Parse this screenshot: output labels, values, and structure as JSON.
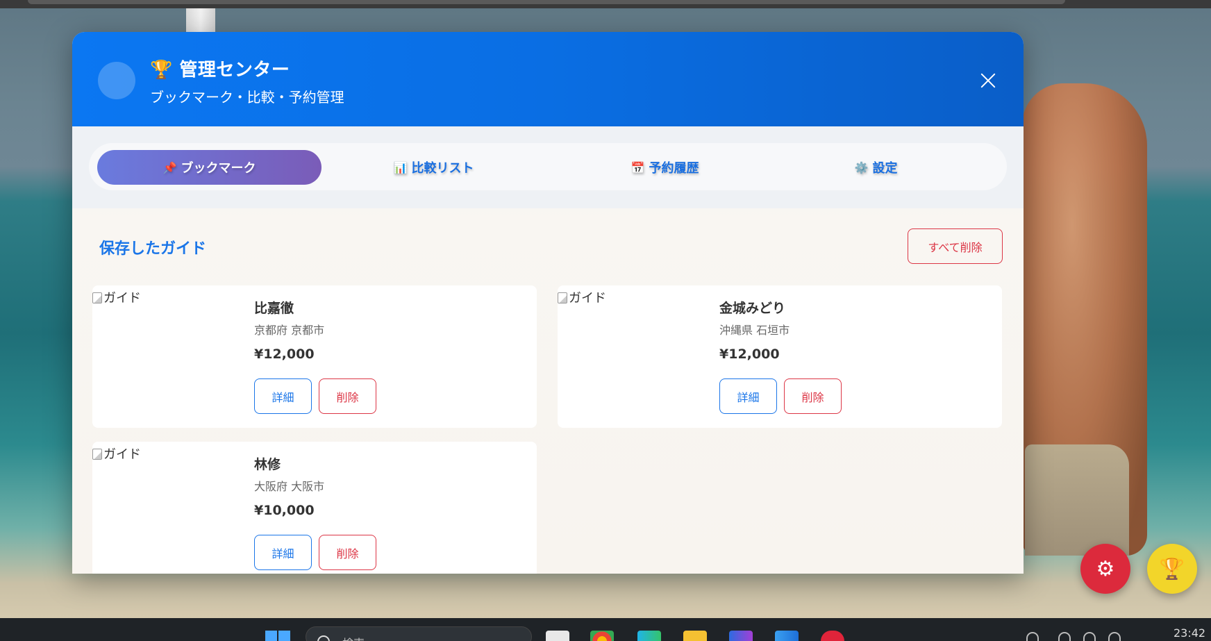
{
  "modal": {
    "title": "🏆 管理センター",
    "subtitle": "ブックマーク・比較・予約管理"
  },
  "tabs": [
    {
      "icon": "📌",
      "label": "ブックマーク",
      "active": true
    },
    {
      "icon": "📊",
      "label": "比較リスト",
      "active": false
    },
    {
      "icon": "📅",
      "label": "予約履歴",
      "active": false
    },
    {
      "icon": "⚙️",
      "label": "設定",
      "active": false
    }
  ],
  "section": {
    "title": "保存したガイド",
    "delete_all_label": "すべて削除"
  },
  "guides": [
    {
      "img_alt": "ガイド",
      "name": "比嘉徹",
      "location": "京都府 京都市",
      "price": "¥12,000",
      "detail_label": "詳細",
      "delete_label": "削除"
    },
    {
      "img_alt": "ガイド",
      "name": "金城みどり",
      "location": "沖縄県 石垣市",
      "price": "¥12,000",
      "detail_label": "詳細",
      "delete_label": "削除"
    },
    {
      "img_alt": "ガイド",
      "name": "林修",
      "location": "大阪府 大阪市",
      "price": "¥10,000",
      "detail_label": "詳細",
      "delete_label": "削除"
    }
  ],
  "fabs": {
    "settings_icon": "⚙",
    "trophy_icon": "🏆"
  },
  "taskbar": {
    "search_placeholder": "検索",
    "clock": "23:42"
  },
  "colors": {
    "header_blue": "#0b77f2",
    "accent_blue": "#1a75e8",
    "danger_red": "#dc3545",
    "tab_active_start": "#6a7bde",
    "tab_active_end": "#7a5cb8"
  }
}
